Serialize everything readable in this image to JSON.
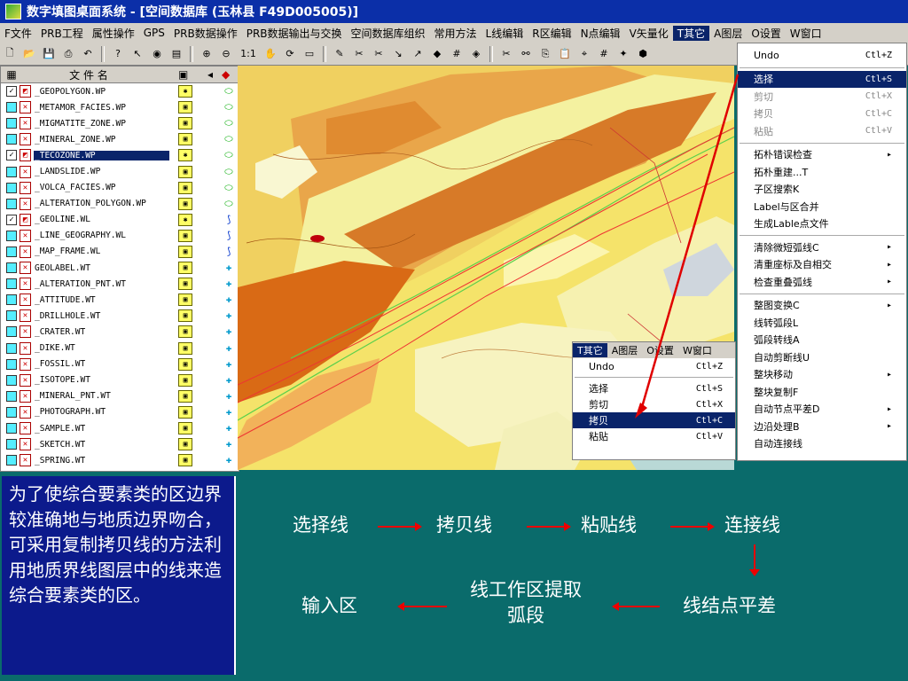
{
  "window": {
    "title": "数字填图桌面系统 - [空间数据库    (玉林县     F49D005005)]"
  },
  "menubar": [
    {
      "label": "F文件"
    },
    {
      "label": "PRB工程"
    },
    {
      "label": "属性操作"
    },
    {
      "label": "GPS"
    },
    {
      "label": "PRB数据操作"
    },
    {
      "label": "PRB数据输出与交换"
    },
    {
      "label": "空间数据库组织"
    },
    {
      "label": "常用方法"
    },
    {
      "label": "L线编辑"
    },
    {
      "label": "R区编辑"
    },
    {
      "label": "N点编辑"
    },
    {
      "label": "V矢量化"
    },
    {
      "label": "T其它"
    },
    {
      "label": "A图层"
    },
    {
      "label": "O设置"
    },
    {
      "label": "W窗口"
    }
  ],
  "toolbar": {
    "icons": [
      "new-icon",
      "open-icon",
      "save-icon",
      "print-icon",
      "undo-icon",
      "help-icon",
      "whatis-icon",
      "eye-icon",
      "layer-icon",
      "zoom-in-icon",
      "zoom-out-icon",
      "one-to-one-icon",
      "pan-icon",
      "redraw-icon",
      "window-icon",
      "draw-line-icon",
      "cut-line-icon",
      "cut-line2-icon",
      "extend-icon",
      "extend2-icon",
      "node-icon",
      "grid-icon",
      "node-edit-icon",
      "scissor-icon",
      "link-icon",
      "copy-icon",
      "paste-icon",
      "snap-icon",
      "grid2-icon",
      "vector-icon",
      "area-icon"
    ],
    "zoom_label": "1:1"
  },
  "filelist": {
    "header": {
      "name_label": "文 件 名"
    },
    "files": [
      {
        "name": "_GEOPOLYGON.WP",
        "checked": true,
        "selected": false,
        "type": "poly"
      },
      {
        "name": "_METAMOR_FACIES.WP",
        "checked": false,
        "selected": false,
        "type": "poly"
      },
      {
        "name": "_MIGMATITE_ZONE.WP",
        "checked": false,
        "selected": false,
        "type": "poly"
      },
      {
        "name": "_MINERAL_ZONE.WP",
        "checked": false,
        "selected": false,
        "type": "poly"
      },
      {
        "name": "_TECOZONE.WP",
        "checked": true,
        "selected": true,
        "type": "poly"
      },
      {
        "name": "_LANDSLIDE.WP",
        "checked": false,
        "selected": false,
        "type": "poly"
      },
      {
        "name": "_VOLCA_FACIES.WP",
        "checked": false,
        "selected": false,
        "type": "poly"
      },
      {
        "name": "_ALTERATION_POLYGON.WP",
        "checked": false,
        "selected": false,
        "type": "poly"
      },
      {
        "name": "_GEOLINE.WL",
        "checked": true,
        "selected": false,
        "type": "line"
      },
      {
        "name": "_LINE_GEOGRAPHY.WL",
        "checked": false,
        "selected": false,
        "type": "line"
      },
      {
        "name": "_MAP_FRAME.WL",
        "checked": false,
        "selected": false,
        "type": "line"
      },
      {
        "name": "GEOLABEL.WT",
        "checked": false,
        "selected": false,
        "type": "point"
      },
      {
        "name": "_ALTERATION_PNT.WT",
        "checked": false,
        "selected": false,
        "type": "point"
      },
      {
        "name": "_ATTITUDE.WT",
        "checked": false,
        "selected": false,
        "type": "point"
      },
      {
        "name": "_DRILLHOLE.WT",
        "checked": false,
        "selected": false,
        "type": "point"
      },
      {
        "name": "_CRATER.WT",
        "checked": false,
        "selected": false,
        "type": "point"
      },
      {
        "name": "_DIKE.WT",
        "checked": false,
        "selected": false,
        "type": "point"
      },
      {
        "name": "_FOSSIL.WT",
        "checked": false,
        "selected": false,
        "type": "point"
      },
      {
        "name": "_ISOTOPE.WT",
        "checked": false,
        "selected": false,
        "type": "point"
      },
      {
        "name": "_MINERAL_PNT.WT",
        "checked": false,
        "selected": false,
        "type": "point"
      },
      {
        "name": "_PHOTOGRAPH.WT",
        "checked": false,
        "selected": false,
        "type": "point"
      },
      {
        "name": "_SAMPLE.WT",
        "checked": false,
        "selected": false,
        "type": "point"
      },
      {
        "name": "_SKETCH.WT",
        "checked": false,
        "selected": false,
        "type": "point"
      },
      {
        "name": "_SPRING.WT",
        "checked": false,
        "selected": false,
        "type": "point"
      }
    ]
  },
  "bigmenu": {
    "items": [
      {
        "label": "Undo",
        "shortcut": "Ctl+Z",
        "state": "normal"
      },
      {
        "sep": true
      },
      {
        "label": "选择",
        "shortcut": "Ctl+S",
        "state": "highlight"
      },
      {
        "label": "剪切",
        "shortcut": "Ctl+X",
        "state": "disabled"
      },
      {
        "label": "拷贝",
        "shortcut": "Ctl+C",
        "state": "disabled"
      },
      {
        "label": "粘贴",
        "shortcut": "Ctl+V",
        "state": "disabled"
      },
      {
        "sep": true
      },
      {
        "label": "拓朴错误检查",
        "shortcut": "▸",
        "state": "normal"
      },
      {
        "label": "拓朴重建...T",
        "shortcut": "",
        "state": "normal"
      },
      {
        "label": "子区搜索K",
        "shortcut": "",
        "state": "normal"
      },
      {
        "label": "Label与区合并",
        "shortcut": "",
        "state": "normal"
      },
      {
        "label": "生成Lable点文件",
        "shortcut": "",
        "state": "normal"
      },
      {
        "sep": true
      },
      {
        "label": "清除微短弧线C",
        "shortcut": "▸",
        "state": "normal"
      },
      {
        "label": "清重座标及自相交",
        "shortcut": "▸",
        "state": "normal"
      },
      {
        "label": "检查重叠弧线",
        "shortcut": "▸",
        "state": "normal"
      },
      {
        "sep": true
      },
      {
        "label": "整图变换C",
        "shortcut": "▸",
        "state": "normal"
      },
      {
        "label": "线转弧段L",
        "shortcut": "",
        "state": "normal"
      },
      {
        "label": "弧段转线A",
        "shortcut": "",
        "state": "normal"
      },
      {
        "label": "自动剪断线U",
        "shortcut": "",
        "state": "normal"
      },
      {
        "label": "整块移动",
        "shortcut": "▸",
        "state": "normal"
      },
      {
        "label": "整块复制F",
        "shortcut": "",
        "state": "normal"
      },
      {
        "label": "自动节点平差D",
        "shortcut": "▸",
        "state": "normal"
      },
      {
        "label": "边沿处理B",
        "shortcut": "▸",
        "state": "normal"
      },
      {
        "label": "自动连接线",
        "shortcut": "",
        "state": "normal"
      }
    ]
  },
  "minimenu": {
    "bar": [
      {
        "label": "T其它",
        "active": true
      },
      {
        "label": "A图层",
        "active": false
      },
      {
        "label": "O设置",
        "active": false
      },
      {
        "label": "W窗口",
        "active": false
      }
    ],
    "items": [
      {
        "label": "Undo",
        "shortcut": "Ctl+Z",
        "state": "normal"
      },
      {
        "sep": true
      },
      {
        "label": "选择",
        "shortcut": "Ctl+S",
        "state": "normal"
      },
      {
        "label": "剪切",
        "shortcut": "Ctl+X",
        "state": "normal"
      },
      {
        "label": "拷贝",
        "shortcut": "Ctl+C",
        "state": "highlight"
      },
      {
        "label": "粘贴",
        "shortcut": "Ctl+V",
        "state": "normal"
      }
    ]
  },
  "textbox": {
    "text": "为了使综合要素类的区边界较准确地与地质边界吻合，可采用复制拷贝线的方法利用地质界线图层中的线来造综合要素类的区。"
  },
  "flow": {
    "step1": "选择线",
    "step2": "拷贝线",
    "step3": "粘贴线",
    "step4": "连接线",
    "step5": "线结点平差",
    "step6": "线工作区提取弧段",
    "step7": "输入区"
  },
  "colors": {
    "titlebar": "#0b2fa8",
    "panel": "#0a6b6b",
    "textbox": "#0c1a8c",
    "arrow": "#e00000",
    "highlight": "#0a246a"
  }
}
